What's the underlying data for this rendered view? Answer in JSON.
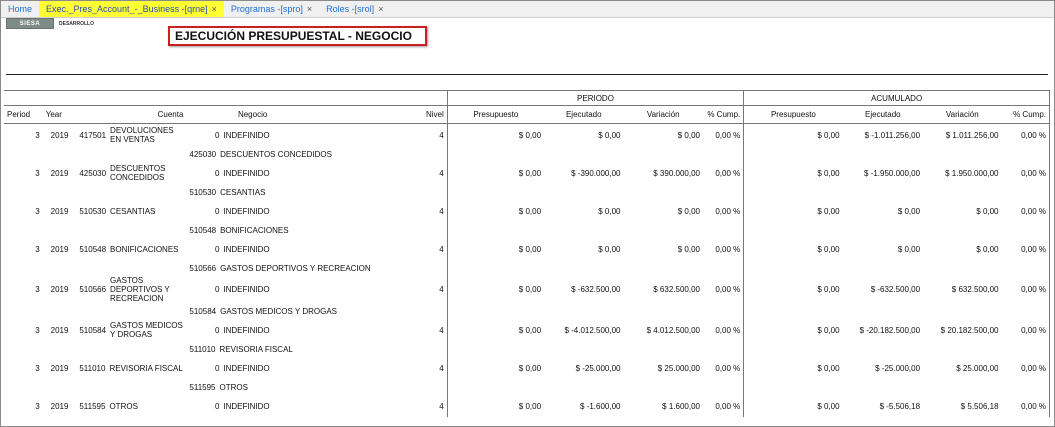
{
  "tabs": [
    {
      "label": "Home",
      "closable": false,
      "active": false
    },
    {
      "label": "Exec._Pres_Account_-_Business -[qrne]",
      "closable": true,
      "active": true
    },
    {
      "label": "Programas -[spro]",
      "closable": true,
      "active": false
    },
    {
      "label": "Roles -[srol]",
      "closable": true,
      "active": false
    }
  ],
  "close_glyph": "×",
  "logo": {
    "text": "SIESA",
    "subtext": "DESARROLLO"
  },
  "report": {
    "title": "EJECUCIÓN PRESUPUESTAL - NEGOCIO",
    "group_headers": {
      "periodo": "PERIODO",
      "acumulado": "ACUMULADO"
    },
    "columns": [
      "Period",
      "Year",
      "Cuenta",
      "Negocio",
      "Nivel",
      "Presupuesto",
      "Ejecutado",
      "Variación",
      "% Cump.",
      "Presupuesto",
      "Ejecutado",
      "Variación",
      "% Cump."
    ],
    "rows": [
      {
        "period": "3",
        "year": "2019",
        "code": "417501",
        "name": "DEVOLUCIONES EN VENTAS",
        "neg_code": "0",
        "neg_name": "INDEFINIDO",
        "nivel": "4",
        "p_pres": "$ 0,00",
        "p_ejec": "$ 0,00",
        "p_var": "$ 0,00",
        "p_cump": "0,00 %",
        "a_pres": "$ 0,00",
        "a_ejec": "$ -1.011.256,00",
        "a_var": "$ 1.011.256,00",
        "a_cump": "0,00 %",
        "subtotal": {
          "code": "425030",
          "name": "DESCUENTOS CONCEDIDOS"
        }
      },
      {
        "period": "3",
        "year": "2019",
        "code": "425030",
        "name": "DESCUENTOS CONCEDIDOS",
        "neg_code": "0",
        "neg_name": "INDEFINIDO",
        "nivel": "4",
        "p_pres": "$ 0,00",
        "p_ejec": "$ -390.000,00",
        "p_var": "$ 390.000,00",
        "p_cump": "0,00 %",
        "a_pres": "$ 0,00",
        "a_ejec": "$ -1.950.000,00",
        "a_var": "$ 1.950.000,00",
        "a_cump": "0,00 %",
        "subtotal": {
          "code": "510530",
          "name": "CESANTIAS"
        }
      },
      {
        "period": "3",
        "year": "2019",
        "code": "510530",
        "name": "CESANTIAS",
        "neg_code": "0",
        "neg_name": "INDEFINIDO",
        "nivel": "4",
        "p_pres": "$ 0,00",
        "p_ejec": "$ 0,00",
        "p_var": "$ 0,00",
        "p_cump": "0,00 %",
        "a_pres": "$ 0,00",
        "a_ejec": "$ 0,00",
        "a_var": "$ 0,00",
        "a_cump": "0,00 %",
        "subtotal": {
          "code": "510548",
          "name": "BONIFICACIONES"
        }
      },
      {
        "period": "3",
        "year": "2019",
        "code": "510548",
        "name": "BONIFICACIONES",
        "neg_code": "0",
        "neg_name": "INDEFINIDO",
        "nivel": "4",
        "p_pres": "$ 0,00",
        "p_ejec": "$ 0,00",
        "p_var": "$ 0,00",
        "p_cump": "0,00 %",
        "a_pres": "$ 0,00",
        "a_ejec": "$ 0,00",
        "a_var": "$ 0,00",
        "a_cump": "0,00 %",
        "subtotal": {
          "code": "510566",
          "name": "GASTOS DEPORTIVOS Y RECREACION"
        }
      },
      {
        "period": "3",
        "year": "2019",
        "code": "510566",
        "name": "GASTOS DEPORTIVOS Y RECREACION",
        "neg_code": "0",
        "neg_name": "INDEFINIDO",
        "nivel": "4",
        "p_pres": "$ 0,00",
        "p_ejec": "$ -632.500,00",
        "p_var": "$ 632.500,00",
        "p_cump": "0,00 %",
        "a_pres": "$ 0,00",
        "a_ejec": "$ -632.500,00",
        "a_var": "$ 632.500,00",
        "a_cump": "0,00 %",
        "subtotal": {
          "code": "510584",
          "name": "GASTOS MEDICOS Y DROGAS"
        }
      },
      {
        "period": "3",
        "year": "2019",
        "code": "510584",
        "name": "GASTOS MEDICOS Y DROGAS",
        "neg_code": "0",
        "neg_name": "INDEFINIDO",
        "nivel": "4",
        "p_pres": "$ 0,00",
        "p_ejec": "$ -4.012.500,00",
        "p_var": "$ 4.012.500,00",
        "p_cump": "0,00 %",
        "a_pres": "$ 0,00",
        "a_ejec": "$ -20.182.500,00",
        "a_var": "$ 20.182.500,00",
        "a_cump": "0,00 %",
        "subtotal": {
          "code": "511010",
          "name": "REVISORIA FISCAL"
        }
      },
      {
        "period": "3",
        "year": "2019",
        "code": "511010",
        "name": "REVISORIA FISCAL",
        "neg_code": "0",
        "neg_name": "INDEFINIDO",
        "nivel": "4",
        "p_pres": "$ 0,00",
        "p_ejec": "$ -25.000,00",
        "p_var": "$ 25.000,00",
        "p_cump": "0,00 %",
        "a_pres": "$ 0,00",
        "a_ejec": "$ -25.000,00",
        "a_var": "$ 25.000,00",
        "a_cump": "0,00 %",
        "subtotal": {
          "code": "511595",
          "name": "OTROS"
        }
      },
      {
        "period": "3",
        "year": "2019",
        "code": "511595",
        "name": "OTROS",
        "neg_code": "0",
        "neg_name": "INDEFINIDO",
        "nivel": "4",
        "p_pres": "$ 0,00",
        "p_ejec": "$ -1.600,00",
        "p_var": "$ 1.600,00",
        "p_cump": "0,00 %",
        "a_pres": "$ 0,00",
        "a_ejec": "$ -5.506,18",
        "a_var": "$ 5.506,18",
        "a_cump": "0,00 %",
        "subtotal": null
      }
    ]
  },
  "colors": {
    "active_tab": "#ffff33",
    "tab_text": "#1f6fd1",
    "title_border": "#c91f1f"
  }
}
